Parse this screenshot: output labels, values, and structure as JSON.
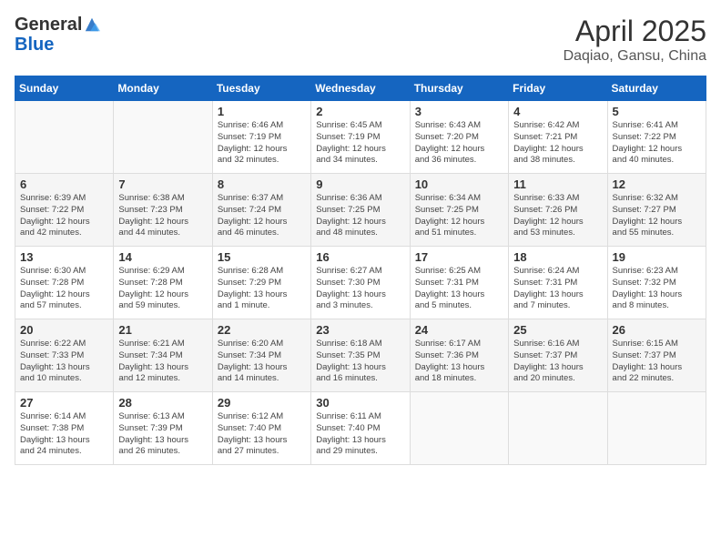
{
  "header": {
    "logo_general": "General",
    "logo_blue": "Blue",
    "month": "April 2025",
    "location": "Daqiao, Gansu, China"
  },
  "days_of_week": [
    "Sunday",
    "Monday",
    "Tuesday",
    "Wednesday",
    "Thursday",
    "Friday",
    "Saturday"
  ],
  "weeks": [
    [
      {
        "day": "",
        "info": ""
      },
      {
        "day": "",
        "info": ""
      },
      {
        "day": "1",
        "info": "Sunrise: 6:46 AM\nSunset: 7:19 PM\nDaylight: 12 hours\nand 32 minutes."
      },
      {
        "day": "2",
        "info": "Sunrise: 6:45 AM\nSunset: 7:19 PM\nDaylight: 12 hours\nand 34 minutes."
      },
      {
        "day": "3",
        "info": "Sunrise: 6:43 AM\nSunset: 7:20 PM\nDaylight: 12 hours\nand 36 minutes."
      },
      {
        "day": "4",
        "info": "Sunrise: 6:42 AM\nSunset: 7:21 PM\nDaylight: 12 hours\nand 38 minutes."
      },
      {
        "day": "5",
        "info": "Sunrise: 6:41 AM\nSunset: 7:22 PM\nDaylight: 12 hours\nand 40 minutes."
      }
    ],
    [
      {
        "day": "6",
        "info": "Sunrise: 6:39 AM\nSunset: 7:22 PM\nDaylight: 12 hours\nand 42 minutes."
      },
      {
        "day": "7",
        "info": "Sunrise: 6:38 AM\nSunset: 7:23 PM\nDaylight: 12 hours\nand 44 minutes."
      },
      {
        "day": "8",
        "info": "Sunrise: 6:37 AM\nSunset: 7:24 PM\nDaylight: 12 hours\nand 46 minutes."
      },
      {
        "day": "9",
        "info": "Sunrise: 6:36 AM\nSunset: 7:25 PM\nDaylight: 12 hours\nand 48 minutes."
      },
      {
        "day": "10",
        "info": "Sunrise: 6:34 AM\nSunset: 7:25 PM\nDaylight: 12 hours\nand 51 minutes."
      },
      {
        "day": "11",
        "info": "Sunrise: 6:33 AM\nSunset: 7:26 PM\nDaylight: 12 hours\nand 53 minutes."
      },
      {
        "day": "12",
        "info": "Sunrise: 6:32 AM\nSunset: 7:27 PM\nDaylight: 12 hours\nand 55 minutes."
      }
    ],
    [
      {
        "day": "13",
        "info": "Sunrise: 6:30 AM\nSunset: 7:28 PM\nDaylight: 12 hours\nand 57 minutes."
      },
      {
        "day": "14",
        "info": "Sunrise: 6:29 AM\nSunset: 7:28 PM\nDaylight: 12 hours\nand 59 minutes."
      },
      {
        "day": "15",
        "info": "Sunrise: 6:28 AM\nSunset: 7:29 PM\nDaylight: 13 hours\nand 1 minute."
      },
      {
        "day": "16",
        "info": "Sunrise: 6:27 AM\nSunset: 7:30 PM\nDaylight: 13 hours\nand 3 minutes."
      },
      {
        "day": "17",
        "info": "Sunrise: 6:25 AM\nSunset: 7:31 PM\nDaylight: 13 hours\nand 5 minutes."
      },
      {
        "day": "18",
        "info": "Sunrise: 6:24 AM\nSunset: 7:31 PM\nDaylight: 13 hours\nand 7 minutes."
      },
      {
        "day": "19",
        "info": "Sunrise: 6:23 AM\nSunset: 7:32 PM\nDaylight: 13 hours\nand 8 minutes."
      }
    ],
    [
      {
        "day": "20",
        "info": "Sunrise: 6:22 AM\nSunset: 7:33 PM\nDaylight: 13 hours\nand 10 minutes."
      },
      {
        "day": "21",
        "info": "Sunrise: 6:21 AM\nSunset: 7:34 PM\nDaylight: 13 hours\nand 12 minutes."
      },
      {
        "day": "22",
        "info": "Sunrise: 6:20 AM\nSunset: 7:34 PM\nDaylight: 13 hours\nand 14 minutes."
      },
      {
        "day": "23",
        "info": "Sunrise: 6:18 AM\nSunset: 7:35 PM\nDaylight: 13 hours\nand 16 minutes."
      },
      {
        "day": "24",
        "info": "Sunrise: 6:17 AM\nSunset: 7:36 PM\nDaylight: 13 hours\nand 18 minutes."
      },
      {
        "day": "25",
        "info": "Sunrise: 6:16 AM\nSunset: 7:37 PM\nDaylight: 13 hours\nand 20 minutes."
      },
      {
        "day": "26",
        "info": "Sunrise: 6:15 AM\nSunset: 7:37 PM\nDaylight: 13 hours\nand 22 minutes."
      }
    ],
    [
      {
        "day": "27",
        "info": "Sunrise: 6:14 AM\nSunset: 7:38 PM\nDaylight: 13 hours\nand 24 minutes."
      },
      {
        "day": "28",
        "info": "Sunrise: 6:13 AM\nSunset: 7:39 PM\nDaylight: 13 hours\nand 26 minutes."
      },
      {
        "day": "29",
        "info": "Sunrise: 6:12 AM\nSunset: 7:40 PM\nDaylight: 13 hours\nand 27 minutes."
      },
      {
        "day": "30",
        "info": "Sunrise: 6:11 AM\nSunset: 7:40 PM\nDaylight: 13 hours\nand 29 minutes."
      },
      {
        "day": "",
        "info": ""
      },
      {
        "day": "",
        "info": ""
      },
      {
        "day": "",
        "info": ""
      }
    ]
  ]
}
